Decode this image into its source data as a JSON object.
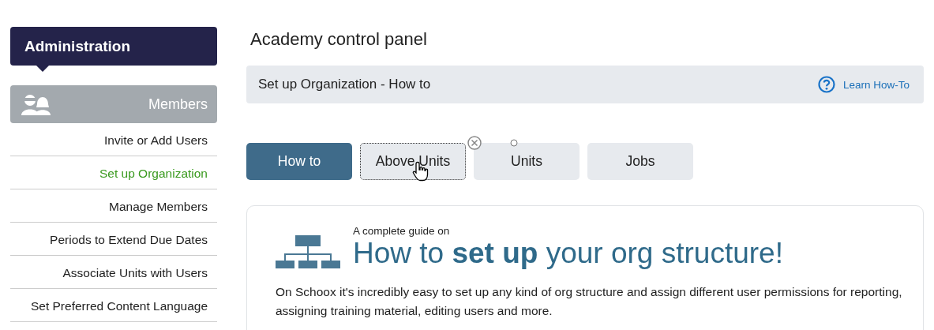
{
  "sidebar": {
    "header": "Administration",
    "section": {
      "label": "Members"
    },
    "items": [
      {
        "label": "Invite or Add Users",
        "selected": false
      },
      {
        "label": "Set up Organization",
        "selected": true
      },
      {
        "label": "Manage Members",
        "selected": false
      },
      {
        "label": "Periods to Extend Due Dates",
        "selected": false
      },
      {
        "label": "Associate Units with Users",
        "selected": false
      },
      {
        "label": "Set Preferred Content Language",
        "selected": false
      }
    ]
  },
  "page_title": "Academy control panel",
  "banner": {
    "title": "Set up Organization - How to",
    "link": "Learn How-To"
  },
  "tabs": [
    {
      "label": "How to",
      "selected": true,
      "focused": false
    },
    {
      "label": "Above Units",
      "selected": false,
      "focused": true
    },
    {
      "label": "Units",
      "selected": false,
      "focused": false
    },
    {
      "label": "Jobs",
      "selected": false,
      "focused": false
    }
  ],
  "card": {
    "kicker": "A complete guide on",
    "headline": "How to **set up** your org structure!",
    "body": "On Schoox it's incredibly easy to set up any kind of org structure and assign different user permissions for reporting, assigning training material, editing users and more."
  }
}
